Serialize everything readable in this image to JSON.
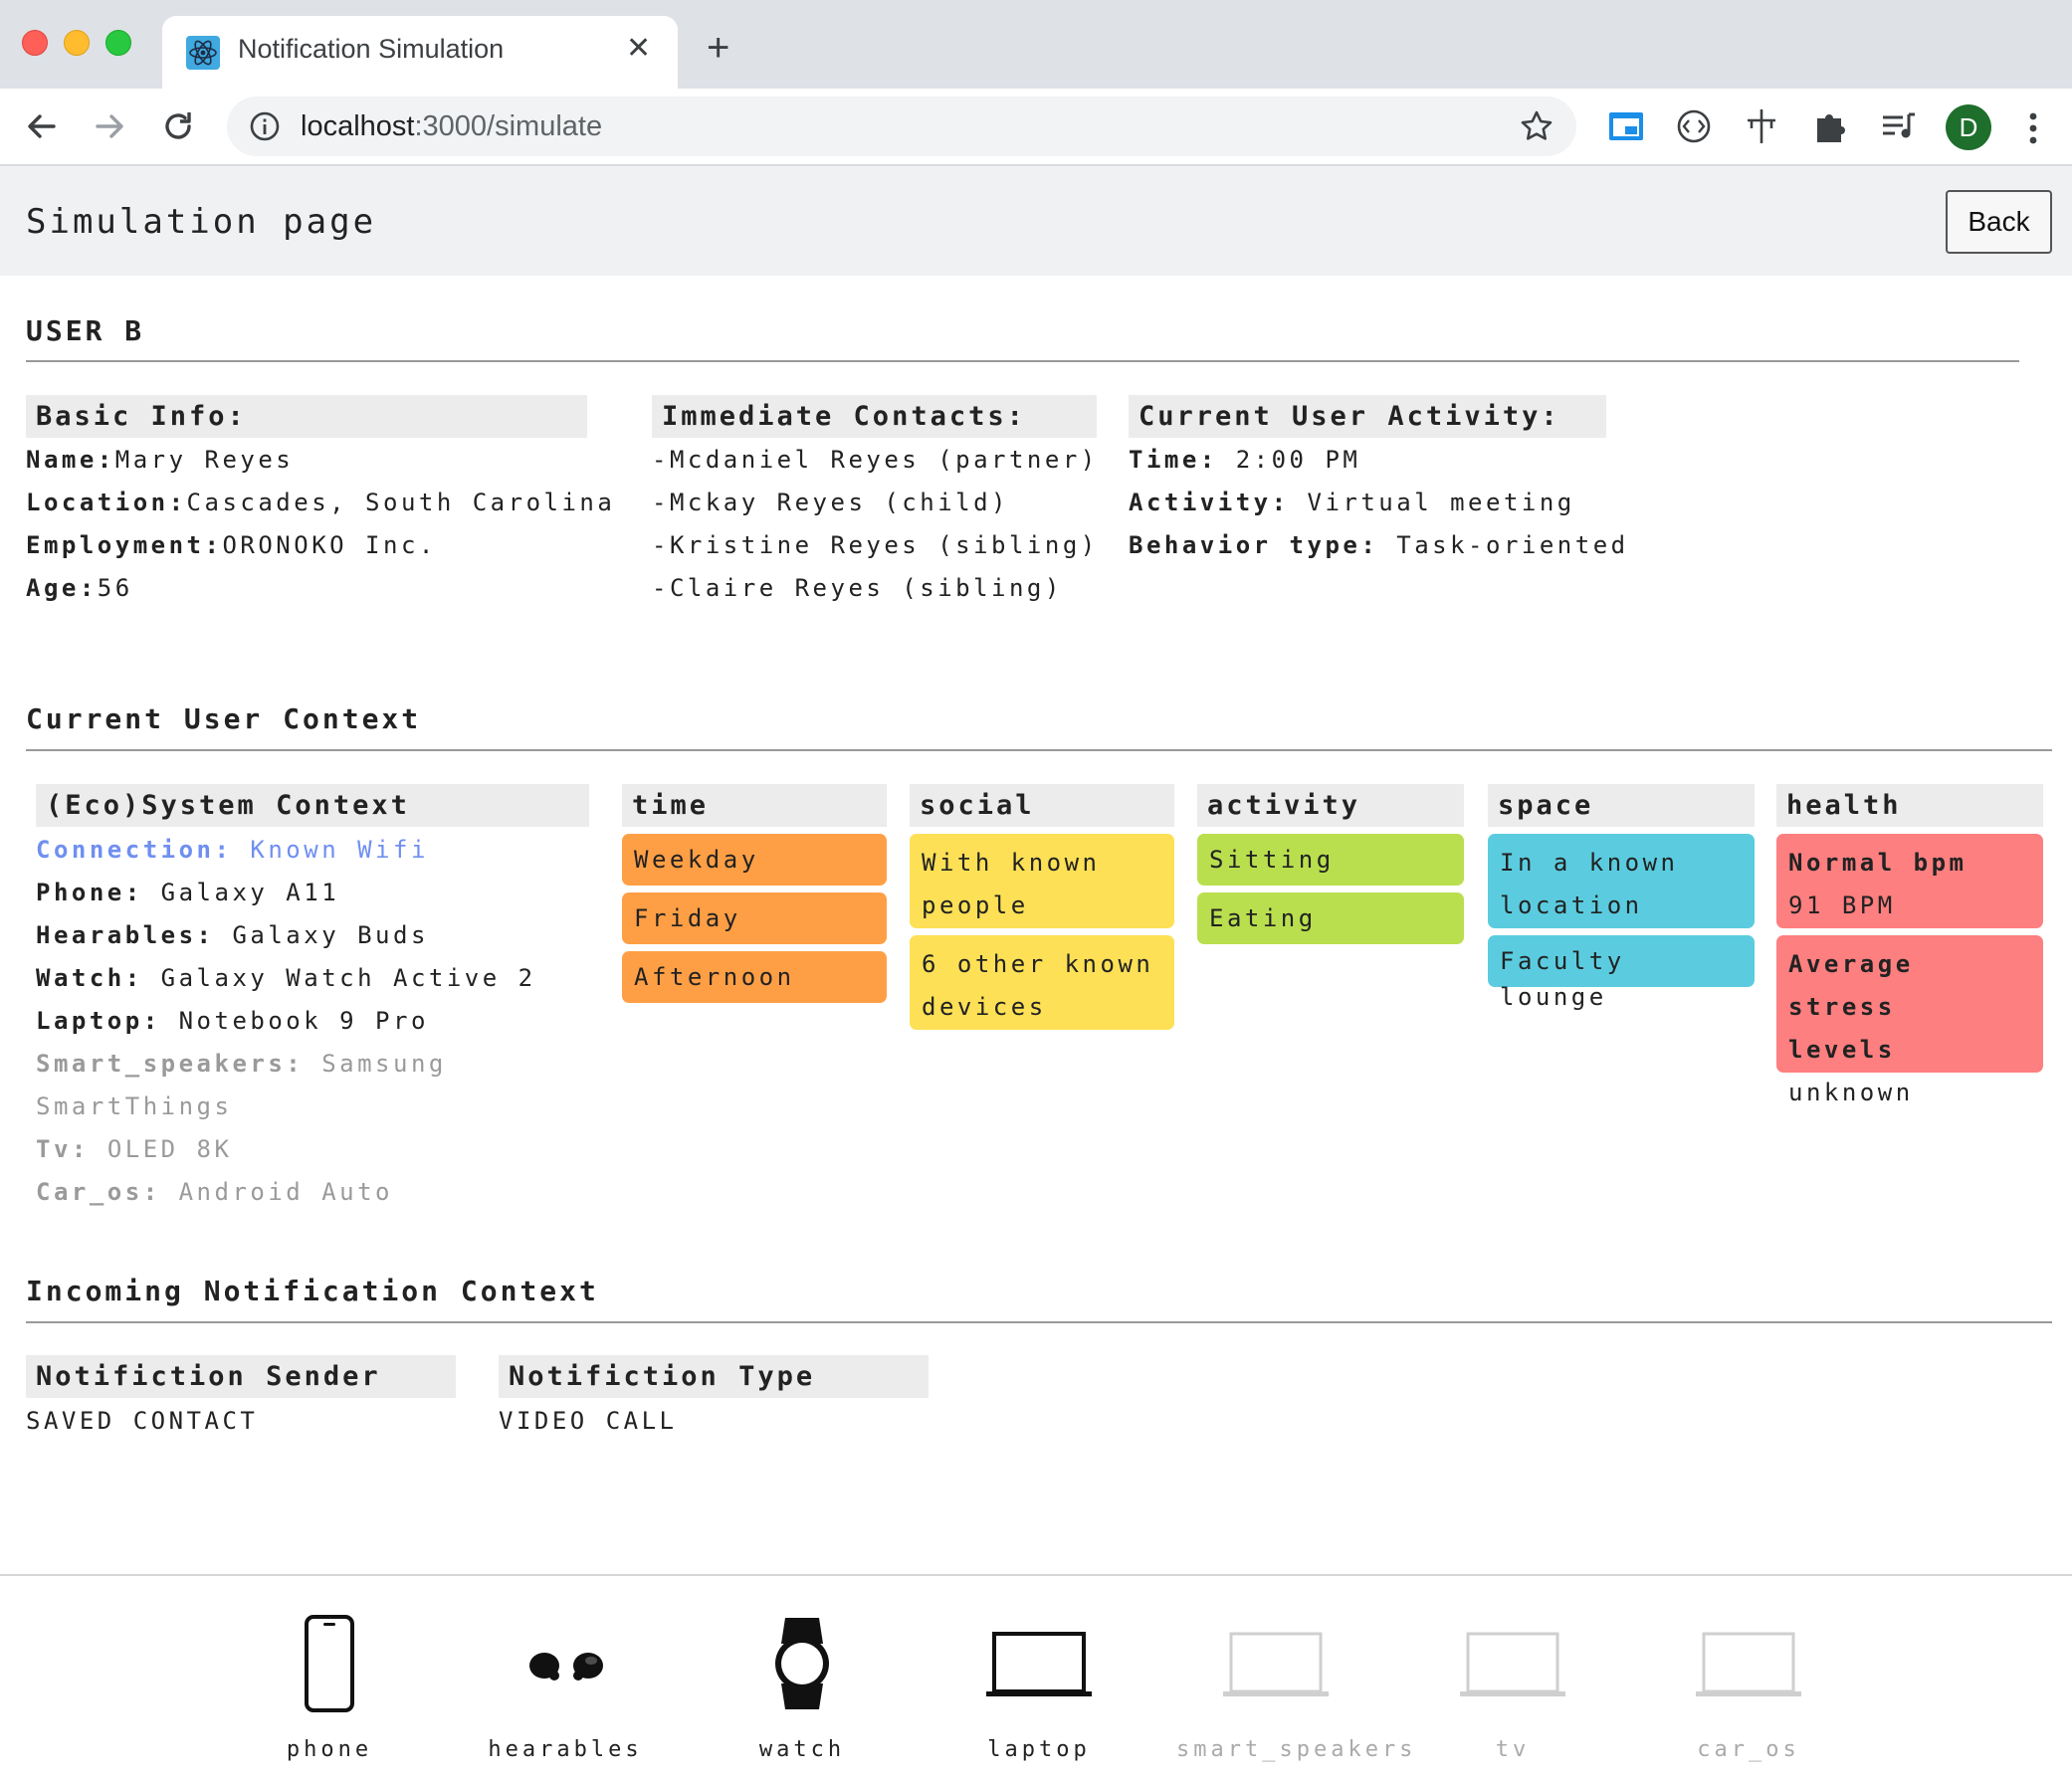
{
  "browser": {
    "tab_title": "Notification Simulation",
    "new_tab": "+",
    "url_host": "localhost",
    "url_path": ":3000/simulate",
    "avatar_letter": "D"
  },
  "header": {
    "title": "Simulation page",
    "back_label": "Back"
  },
  "user": {
    "heading": "USER B",
    "basic_info": {
      "title": "Basic Info:",
      "name_label": "Name:",
      "name": "Mary Reyes",
      "location_label": "Location:",
      "location": "Cascades, South Carolina",
      "employment_label": "Employment:",
      "employment": "ORONOKO Inc.",
      "age_label": "Age:",
      "age": "56"
    },
    "contacts": {
      "title": "Immediate Contacts:",
      "items": [
        "-Mcdaniel Reyes (partner)",
        "-Mckay Reyes (child)",
        "-Kristine Reyes (sibling)",
        "-Claire Reyes (sibling)"
      ]
    },
    "activity": {
      "title": "Current User Activity:",
      "time_label": "Time:",
      "time": "2:00 PM",
      "activity_label": "Activity:",
      "activity": "Virtual meeting",
      "behavior_label": "Behavior type:",
      "behavior": "Task-oriented"
    }
  },
  "context": {
    "heading": "Current User Context",
    "ecosystem": {
      "title": "(Eco)System Context",
      "connection_label": "Connection:",
      "connection": "Known Wifi",
      "phone_label": "Phone:",
      "phone": "Galaxy A11",
      "hearables_label": "Hearables:",
      "hearables": "Galaxy Buds",
      "watch_label": "Watch:",
      "watch": "Galaxy Watch Active 2",
      "laptop_label": "Laptop:",
      "laptop": "Notebook 9 Pro",
      "speakers_label": "Smart_speakers:",
      "speakers_a": "Samsung",
      "speakers_b": "SmartThings",
      "tv_label": "Tv:",
      "tv": "OLED 8K",
      "car_label": "Car_os:",
      "car": "Android Auto"
    },
    "time": {
      "title": "time",
      "chips": [
        "Weekday",
        "Friday",
        "Afternoon"
      ]
    },
    "social": {
      "title": "social",
      "chip1_a": "With known",
      "chip1_b": "people",
      "chip2_a": "6 other known",
      "chip2_b": "devices"
    },
    "activity": {
      "title": "activity",
      "chips": [
        "Sitting",
        "Eating"
      ]
    },
    "space": {
      "title": "space",
      "chip1_a": "In a known",
      "chip1_b": "location",
      "chip2": "Faculty lounge"
    },
    "health": {
      "title": "health",
      "chip1_a": "Normal bpm",
      "chip1_b": "91 BPM",
      "chip2_a": "Average stress",
      "chip2_b": "levels",
      "chip2_c": "unknown"
    }
  },
  "notification": {
    "heading": "Incoming Notification Context",
    "sender_title": "Notifiction Sender",
    "sender": "SAVED CONTACT",
    "type_title": "Notifiction Type",
    "type": "VIDEO CALL"
  },
  "devices": [
    {
      "label": "phone",
      "icon": "phone-icon",
      "active": true
    },
    {
      "label": "hearables",
      "icon": "earbuds-icon",
      "active": true
    },
    {
      "label": "watch",
      "icon": "watch-icon",
      "active": true
    },
    {
      "label": "laptop",
      "icon": "laptop-icon",
      "active": true
    },
    {
      "label": "smart_speakers",
      "icon": "laptop-icon",
      "active": false
    },
    {
      "label": "tv",
      "icon": "laptop-icon",
      "active": false
    },
    {
      "label": "car_os",
      "icon": "laptop-icon",
      "active": false
    }
  ],
  "colors": {
    "time": "#ff9f45",
    "social": "#fde055",
    "activity": "#b9df4e",
    "space": "#5bccdf",
    "health": "#fe7f80",
    "connection": "#6f8ff0",
    "avatar": "#1e6e2c"
  }
}
